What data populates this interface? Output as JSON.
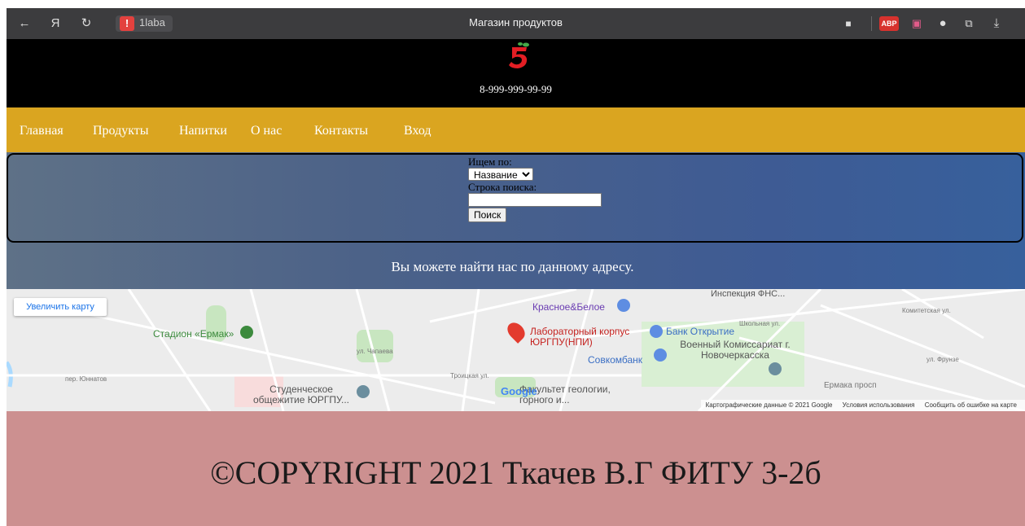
{
  "browser": {
    "tab_label": "1laba",
    "window_title": "Магазин продуктов",
    "abp_label": "ABP"
  },
  "header": {
    "phone": "8-999-999-99-99"
  },
  "nav": {
    "items": [
      "Главная",
      "Продукты",
      "Напитки",
      "О нас",
      "Контакты",
      "Вход"
    ]
  },
  "search": {
    "search_by_label": "Ищем по:",
    "select_value": "Название",
    "query_label": "Строка поиска:",
    "query_value": "",
    "button_label": "Поиск"
  },
  "address_text": "Вы можете найти нас по данному адресу.",
  "map": {
    "enlarge_label": "Увеличить карту",
    "pois": [
      "Стадион «Ермак»",
      "Красное&Белое",
      "Лабораторный корпус ЮРГПУ(НПИ)",
      "Банк Открытие",
      "Военный Комиссариат г. Новочеркасска",
      "Совкомбанк",
      "Студенческое общежитие ЮРГПУ...",
      "Факультет геологии, горного и..."
    ],
    "street_labels": [
      "пер. Юннатов",
      "ул. Чапаева",
      "Ермака просп",
      "Троицкая ул.",
      "Школьная ул.",
      "ул. Фрунзе",
      "Комитетская ул."
    ],
    "top_label": "Инспекция ФНС...",
    "google_logo": "Google",
    "map_data": "Картографические данные © 2021 Google",
    "terms": "Условия использования",
    "report": "Сообщить об ошибке на карте"
  },
  "footer": {
    "copyright": "©COPYRIGHT 2021 Ткачев В.Г ФИТУ 3-2б"
  },
  "colors": {
    "header_bg": "#000000",
    "nav_bg": "#daa520",
    "footer_bg": "#cc9090",
    "search_gradient": "#4c6288"
  }
}
